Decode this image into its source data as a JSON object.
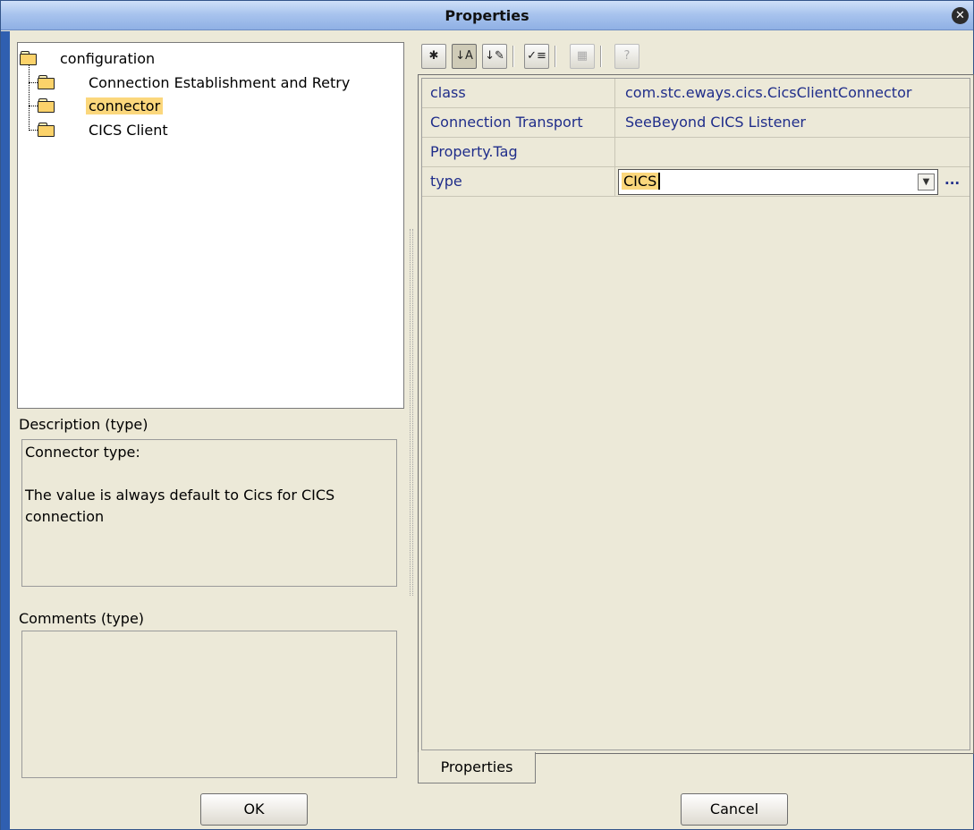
{
  "window": {
    "title": "Properties"
  },
  "tree": {
    "root": "configuration",
    "children": [
      {
        "label": "Connection Establishment and Retry",
        "selected": false
      },
      {
        "label": "connector",
        "selected": true
      },
      {
        "label": "CICS Client",
        "selected": false
      }
    ]
  },
  "description": {
    "label": "Description (type)",
    "line1": "Connector type:",
    "line2": "The value is always default to Cics for CICS connection"
  },
  "comments": {
    "label": "Comments (type)",
    "value": ""
  },
  "toolbar": {
    "buttons": [
      {
        "icon": "categorized-icon",
        "glyph": "✱"
      },
      {
        "icon": "sort-az-icon",
        "glyph": "↓A"
      },
      {
        "icon": "sort-type-icon",
        "glyph": "↓✎"
      },
      {
        "icon": "checklist-icon",
        "glyph": "✓≡"
      },
      {
        "icon": "custom-editor-icon",
        "glyph": "▦"
      },
      {
        "icon": "help-icon",
        "glyph": "?"
      }
    ]
  },
  "properties": {
    "rows": [
      {
        "name": "class",
        "value": "com.stc.eways.cics.CicsClientConnector"
      },
      {
        "name": "Connection Transport",
        "value": "SeeBeyond CICS Listener"
      },
      {
        "name": "Property.Tag",
        "value": ""
      },
      {
        "name": "type",
        "value": "CICS"
      }
    ],
    "editor_more": "..."
  },
  "tabs": {
    "properties": "Properties"
  },
  "buttons": {
    "ok": "OK",
    "cancel": "Cancel"
  },
  "colors": {
    "selection": "#fbd77c",
    "value_text": "#1f2d8a",
    "titlebar": "#a9c4ee"
  }
}
